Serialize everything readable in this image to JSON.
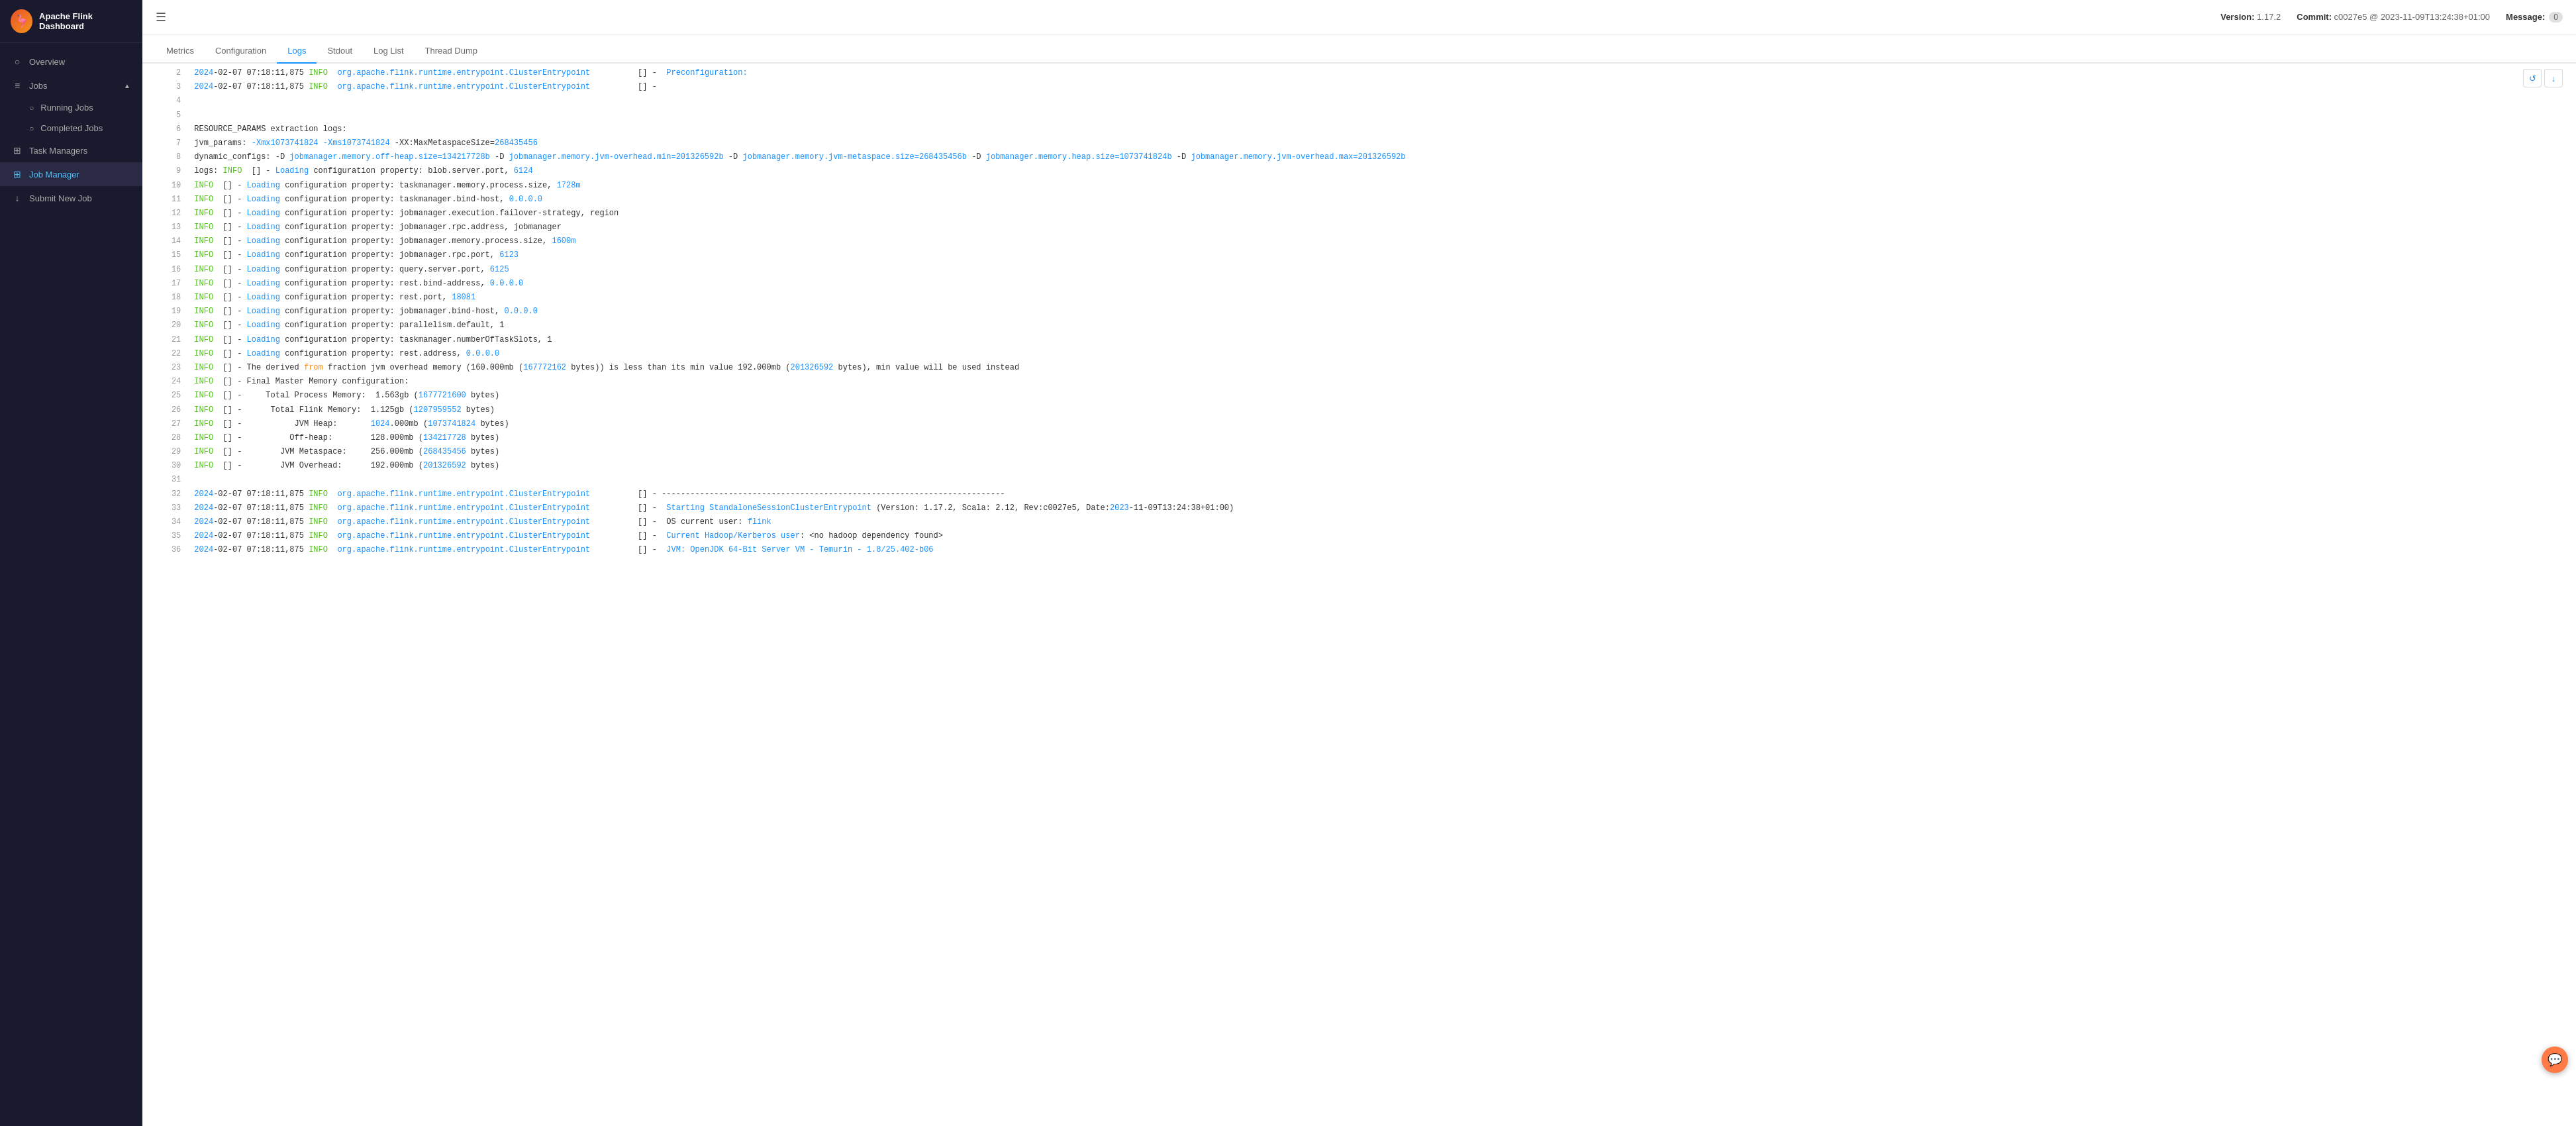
{
  "app": {
    "title": "Apache Flink Dashboard",
    "version_label": "Version:",
    "version_value": "1.17.2",
    "commit_label": "Commit:",
    "commit_value": "c0027e5 @ 2023-11-09T13:24:38+01:00",
    "message_label": "Message:",
    "message_count": "0"
  },
  "sidebar": {
    "logo_emoji": "🦩",
    "nav_items": [
      {
        "id": "overview",
        "label": "Overview",
        "icon": "○",
        "active": false
      },
      {
        "id": "jobs",
        "label": "Jobs",
        "icon": "≡",
        "active": true,
        "has_chevron": true
      },
      {
        "id": "running-jobs",
        "label": "Running Jobs",
        "icon": "○",
        "sub": true,
        "active": false
      },
      {
        "id": "completed-jobs",
        "label": "Completed Jobs",
        "icon": "○",
        "sub": true,
        "active": false
      },
      {
        "id": "task-managers",
        "label": "Task Managers",
        "icon": "⊞",
        "active": false
      },
      {
        "id": "job-manager",
        "label": "Job Manager",
        "icon": "⊞",
        "active": true
      },
      {
        "id": "submit-new-job",
        "label": "Submit New Job",
        "icon": "↓",
        "active": false
      }
    ]
  },
  "tabs": [
    {
      "id": "metrics",
      "label": "Metrics",
      "active": false
    },
    {
      "id": "configuration",
      "label": "Configuration",
      "active": false
    },
    {
      "id": "logs",
      "label": "Logs",
      "active": true
    },
    {
      "id": "stdout",
      "label": "Stdout",
      "active": false
    },
    {
      "id": "log-list",
      "label": "Log List",
      "active": false
    },
    {
      "id": "thread-dump",
      "label": "Thread Dump",
      "active": false
    }
  ],
  "log_lines": [
    {
      "num": "2",
      "content": "2024-02-07 07:18:11,875 INFO  org.apache.flink.runtime.entrypoint.ClusterEntrypoint          [] -  Preconfiguration:"
    },
    {
      "num": "3",
      "content": "2024-02-07 07:18:11,875 INFO  org.apache.flink.runtime.entrypoint.ClusterEntrypoint          [] -"
    },
    {
      "num": "4",
      "content": ""
    },
    {
      "num": "5",
      "content": ""
    },
    {
      "num": "6",
      "content": "RESOURCE_PARAMS extraction logs:"
    },
    {
      "num": "7",
      "content": "jvm_params: -Xmx1073741824 -Xms1073741824 -XX:MaxMetaspaceSize=268435456"
    },
    {
      "num": "8",
      "content": "dynamic_configs: -D jobmanager.memory.off-heap.size=134217728b -D jobmanager.memory.jvm-overhead.min=201326592b -D jobmanager.memory.jvm-metaspace.size=268435456b -D jobmanager.memory.heap.size=1073741824b -D jobmanager.memory.jvm-overhead.max=201326592b"
    },
    {
      "num": "9",
      "content": "logs: INFO  [] - Loading configuration property: blob.server.port, 6124"
    },
    {
      "num": "10",
      "content": "INFO  [] - Loading configuration property: taskmanager.memory.process.size, 1728m"
    },
    {
      "num": "11",
      "content": "INFO  [] - Loading configuration property: taskmanager.bind-host, 0.0.0.0"
    },
    {
      "num": "12",
      "content": "INFO  [] - Loading configuration property: jobmanager.execution.failover-strategy, region"
    },
    {
      "num": "13",
      "content": "INFO  [] - Loading configuration property: jobmanager.rpc.address, jobmanager"
    },
    {
      "num": "14",
      "content": "INFO  [] - Loading configuration property: jobmanager.memory.process.size, 1600m"
    },
    {
      "num": "15",
      "content": "INFO  [] - Loading configuration property: jobmanager.rpc.port, 6123"
    },
    {
      "num": "16",
      "content": "INFO  [] - Loading configuration property: query.server.port, 6125"
    },
    {
      "num": "17",
      "content": "INFO  [] - Loading configuration property: rest.bind-address, 0.0.0.0"
    },
    {
      "num": "18",
      "content": "INFO  [] - Loading configuration property: rest.port, 18081"
    },
    {
      "num": "19",
      "content": "INFO  [] - Loading configuration property: jobmanager.bind-host, 0.0.0.0"
    },
    {
      "num": "20",
      "content": "INFO  [] - Loading configuration property: parallelism.default, 1"
    },
    {
      "num": "21",
      "content": "INFO  [] - Loading configuration property: taskmanager.numberOfTaskSlots, 1"
    },
    {
      "num": "22",
      "content": "INFO  [] - Loading configuration property: rest.address, 0.0.0.0"
    },
    {
      "num": "23",
      "content": "INFO  [] - The derived from fraction jvm overhead memory (160.000mb (167772162 bytes)) is less than its min value 192.000mb (201326592 bytes), min value will be used instead"
    },
    {
      "num": "24",
      "content": "INFO  [] - Final Master Memory configuration:"
    },
    {
      "num": "25",
      "content": "INFO  [] -     Total Process Memory:  1.563gb (1677721600 bytes)"
    },
    {
      "num": "26",
      "content": "INFO  [] -      Total Flink Memory:  1.125gb (1207959552 bytes)"
    },
    {
      "num": "27",
      "content": "INFO  [] -           JVM Heap:       1024.000mb (1073741824 bytes)"
    },
    {
      "num": "28",
      "content": "INFO  [] -          Off-heap:        128.000mb (134217728 bytes)"
    },
    {
      "num": "29",
      "content": "INFO  [] -        JVM Metaspace:     256.000mb (268435456 bytes)"
    },
    {
      "num": "30",
      "content": "INFO  [] -        JVM Overhead:      192.000mb (201326592 bytes)"
    },
    {
      "num": "31",
      "content": ""
    },
    {
      "num": "32",
      "content": "2024-02-07 07:18:11,875 INFO  org.apache.flink.runtime.entrypoint.ClusterEntrypoint          [] - ------------------------------------------------------------------------"
    },
    {
      "num": "33",
      "content": "2024-02-07 07:18:11,875 INFO  org.apache.flink.runtime.entrypoint.ClusterEntrypoint          [] -  Starting StandaloneSessionClusterEntrypoint (Version: 1.17.2, Scala: 2.12, Rev:c0027e5, Date:2023-11-09T13:24:38+01:00)"
    },
    {
      "num": "34",
      "content": "2024-02-07 07:18:11,875 INFO  org.apache.flink.runtime.entrypoint.ClusterEntrypoint          [] -  OS current user: flink"
    },
    {
      "num": "35",
      "content": "2024-02-07 07:18:11,875 INFO  org.apache.flink.runtime.entrypoint.ClusterEntrypoint          [] -  Current Hadoop/Kerberos user: <no hadoop dependency found>"
    },
    {
      "num": "36",
      "content": "2024-02-07 07:18:11,875 INFO  org.apache.flink.runtime.entrypoint.ClusterEntrypoint          [] -  JVM: OpenJDK 64-Bit Server VM - Temurin - 1.8/25.402-b06"
    }
  ]
}
